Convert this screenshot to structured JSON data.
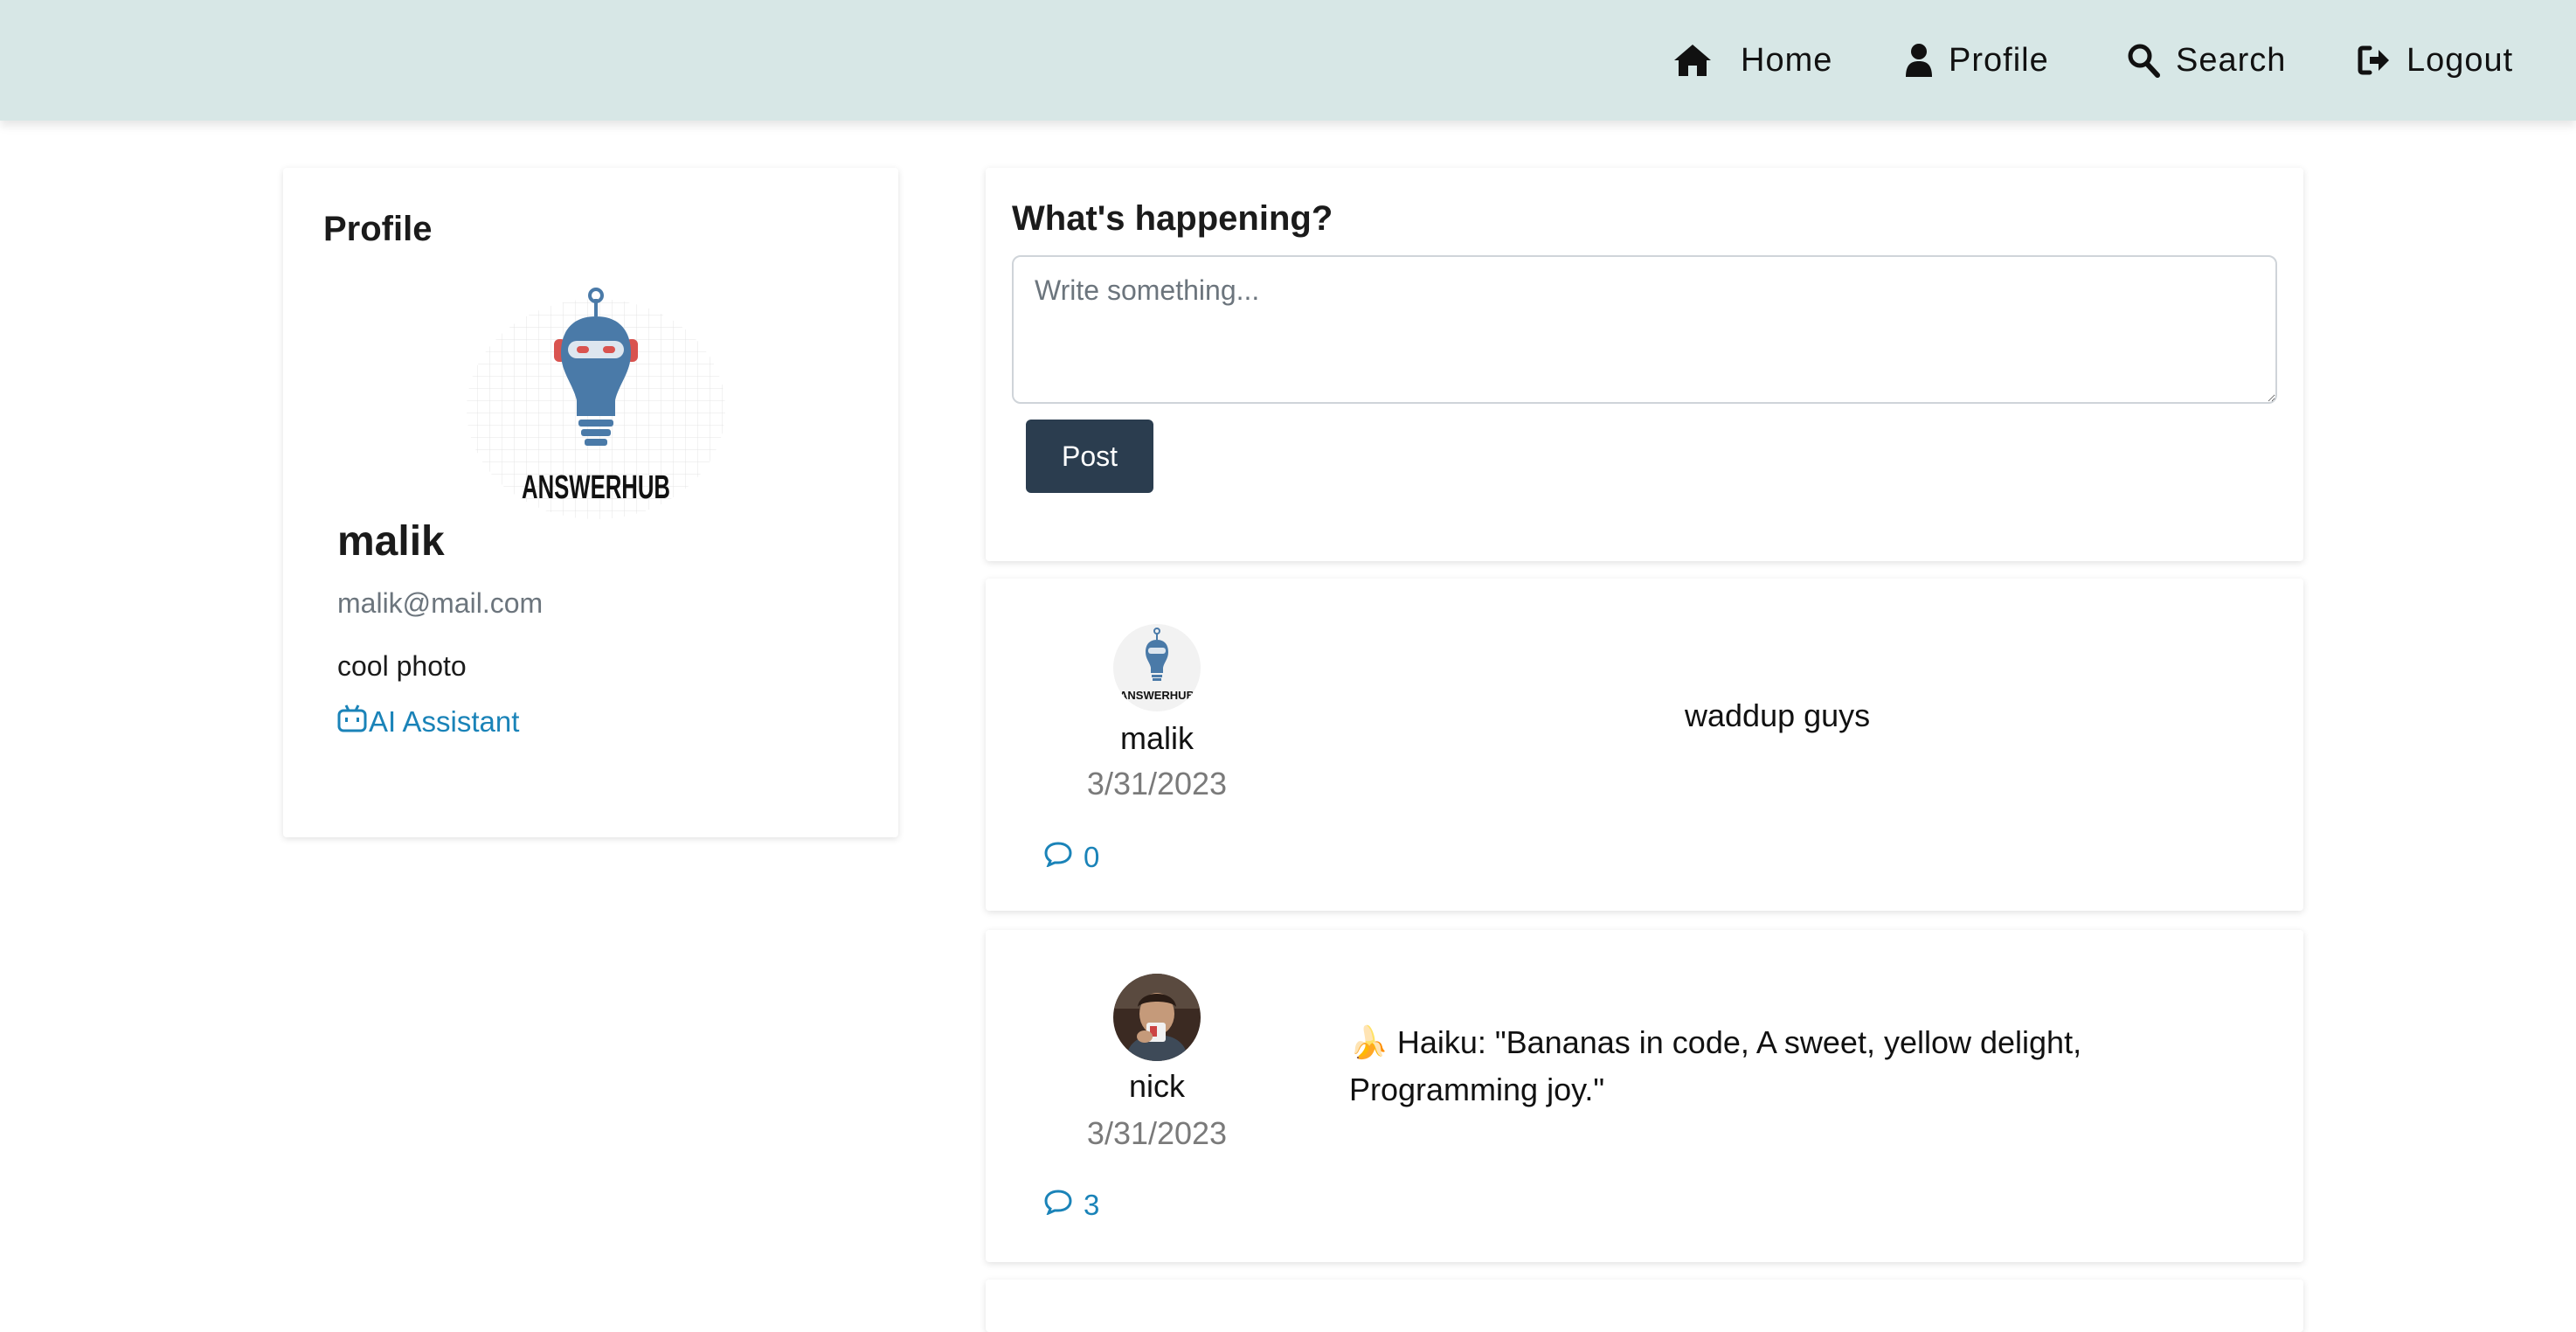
{
  "nav": {
    "home": "Home",
    "profile": "Profile",
    "search": "Search",
    "logout": "Logout"
  },
  "profile": {
    "title": "Profile",
    "avatar_logo_text": "ANSWERHUB",
    "username": "malik",
    "email": "malik@mail.com",
    "bio": "cool photo",
    "ai_link": "AI Assistant"
  },
  "compose": {
    "title": "What's happening?",
    "placeholder": "Write something...",
    "value": "",
    "post_button": "Post"
  },
  "posts": [
    {
      "author": "malik",
      "date": "3/31/2023",
      "content": "waddup guys",
      "comments": "0",
      "avatar_icon": "answerhub-robot-logo"
    },
    {
      "author": "nick",
      "date": "3/31/2023",
      "content": "🍌 Haiku: \"Bananas in code, A sweet, yellow delight, Programming joy.\"",
      "comments": "3",
      "avatar_icon": "user-photo"
    }
  ],
  "colors": {
    "navbar_bg": "#d7e7e6",
    "link": "#1a83b8",
    "button": "#2b3d4f"
  }
}
